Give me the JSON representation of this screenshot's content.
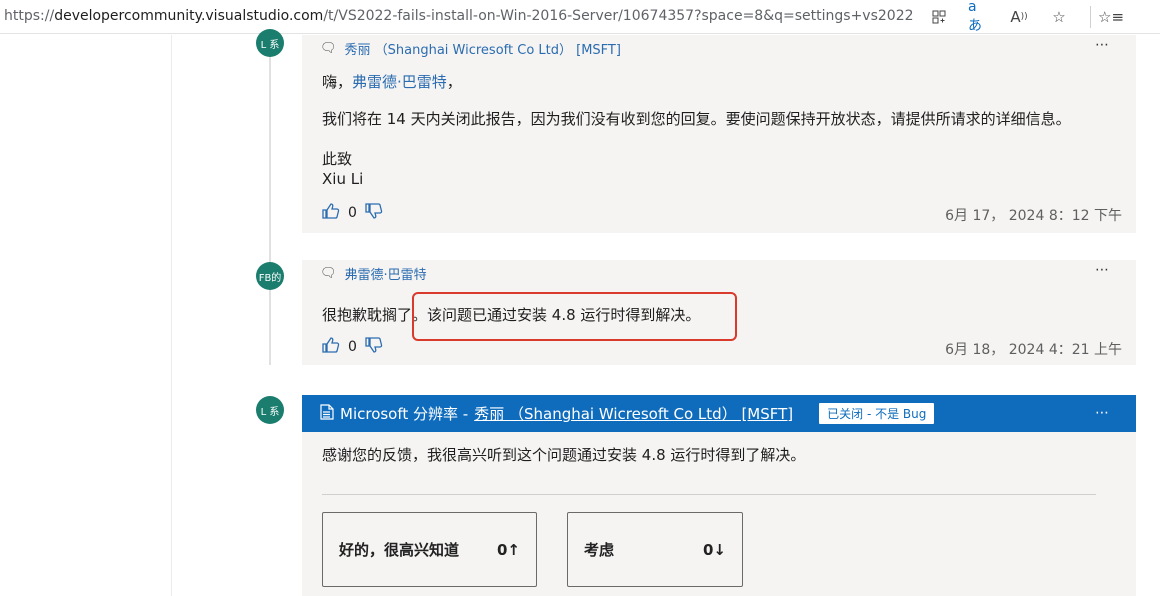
{
  "browser": {
    "url_prefix": "https://",
    "url_host": "developercommunity.visualstudio.com",
    "url_path": "/t/VS2022-fails-install-on-Win-2016-Server/10674357?space=8&q=settings+vs2022"
  },
  "comments": [
    {
      "avatar_text": "L 系",
      "author": "秀丽 （Shanghai Wicresoft Co Ltd） [MSFT]",
      "greeting_prefix": "嗨，",
      "greeting_name": "弗雷德·巴雷特",
      "greeting_suffix": "，",
      "body": "我们将在 14 天内关闭此报告，因为我们没有收到您的回复。要使问题保持开放状态，请提供所请求的详细信息。",
      "sign_1": "此致",
      "sign_2": "Xiu Li",
      "votes": "0",
      "timestamp": "6月 17， 2024 8：12 下午"
    },
    {
      "avatar_text": "FB的",
      "author": "弗雷德·巴雷特",
      "body": "很抱歉耽搁了。该问题已通过安装 4.8 运行时得到解决。",
      "votes": "0",
      "timestamp": "6月 18， 2024 4：21 上午"
    }
  ],
  "resolution": {
    "avatar_text": "L 系",
    "prefix": "Microsoft 分辨率 -",
    "author": "秀丽 （Shanghai Wicresoft Co Ltd） [MSFT]",
    "status": "已关闭 - 不是 Bug",
    "body": "感谢您的反馈，我很高兴听到这个问题通过安装 4.8 运行时得到了解决。",
    "choices": [
      {
        "label": "好的，很高兴知道",
        "count": "0↑"
      },
      {
        "label": "考虑",
        "count": "0↓"
      }
    ]
  },
  "icons": {
    "more": "⋯",
    "comment": "🗨",
    "thumbs_up": "👍",
    "thumbs_down": "👎",
    "doc": "🗎"
  },
  "colors": {
    "accent": "#0f6cbd",
    "link": "#2b6cb0",
    "highlight": "#d93a2b",
    "avatar": "#1a7d6e"
  }
}
